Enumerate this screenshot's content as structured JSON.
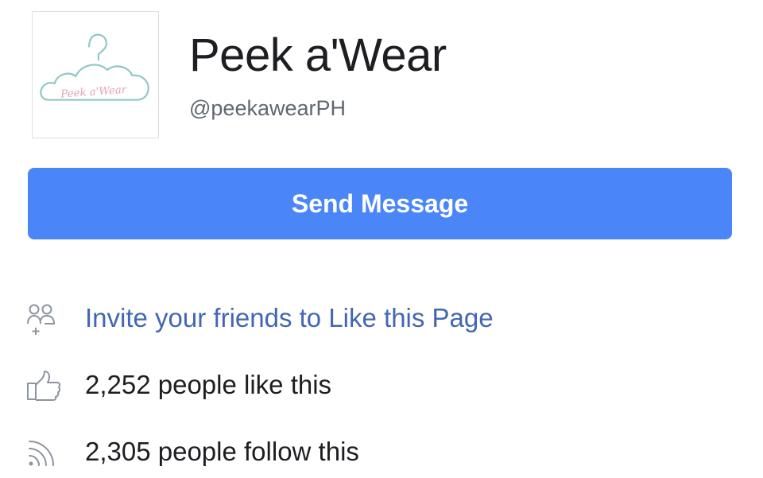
{
  "profile": {
    "name": "Peek a'Wear",
    "handle": "@peekawearPH",
    "logo_text": "Peek a'Wear"
  },
  "actions": {
    "send_message_label": "Send Message"
  },
  "info": {
    "invite_label": "Invite your friends to Like this Page",
    "likes_label": "2,252 people like this",
    "follows_label": "2,305 people follow this"
  },
  "icons": {
    "avatar": "hanger-logo",
    "invite": "invite-friends-icon",
    "likes": "thumbs-up-icon",
    "follows": "rss-icon"
  },
  "colors": {
    "button_bg": "#4a86f7",
    "link": "#4267b2",
    "text_primary": "#1c1e21",
    "text_secondary": "#606770",
    "icon_gray": "#8d949e",
    "logo_teal": "#8fc7c4",
    "logo_pink": "#e3a3b5"
  }
}
